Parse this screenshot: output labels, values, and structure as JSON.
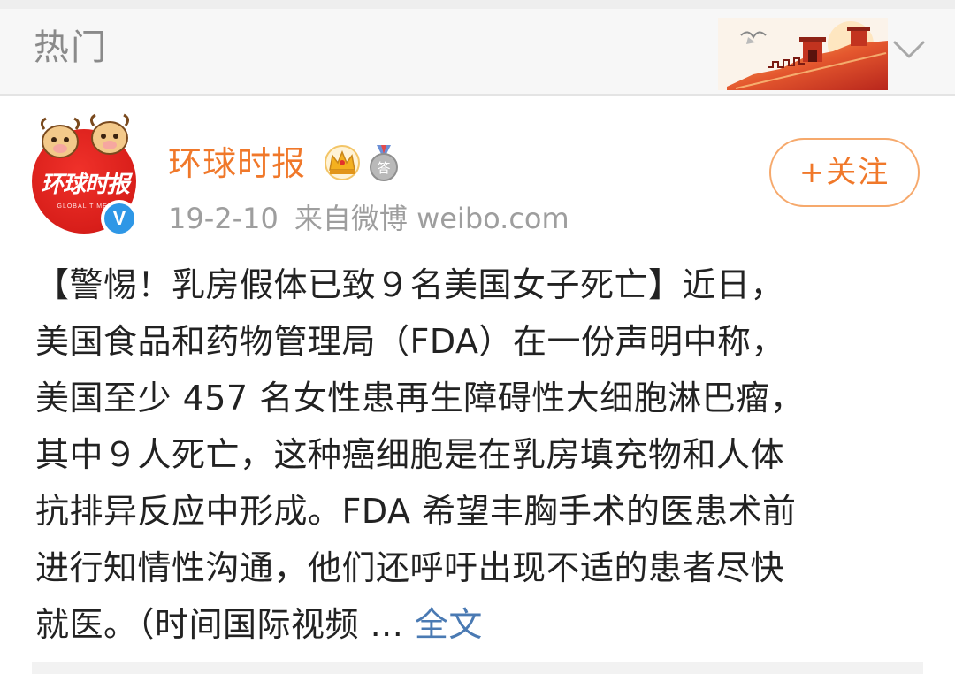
{
  "header": {
    "title": "热门"
  },
  "post": {
    "username": "环球时报",
    "avatar_text": "环球时报",
    "avatar_subtext": "GLOBAL TIMES",
    "verified_mark": "V",
    "date": "19-2-10",
    "source": "来自微博 weibo.com",
    "follow_label": "+关注",
    "text_lines": [
      "【警惕！乳房假体已致９名美国女子死亡】近日，",
      "美国食品和药物管理局（FDA）在一份声明中称，",
      "美国至少 457 名女性患再生障碍性大细胞淋巴瘤，",
      "其中９人死亡，这种癌细胞是在乳房填充物和人体",
      "抗排异反应中形成。FDA 希望丰胸手术的医患术前",
      "进行知情性沟通，他们还呼吁出现不适的患者尽快",
      "就医。（时间国际视频 ... "
    ],
    "full_text_link": "全文",
    "medal_label": "答"
  },
  "colors": {
    "brand_orange": "#f0782a",
    "link_blue": "#4a7ab3",
    "verified_blue": "#2e97e6",
    "avatar_red": "#d81e1a",
    "text_dark": "#222222",
    "text_gray": "#9e9e9e"
  },
  "icons": [
    "great-wall-banner",
    "chevron-down-icon",
    "crown-icon",
    "medal-icon",
    "verified-icon"
  ]
}
